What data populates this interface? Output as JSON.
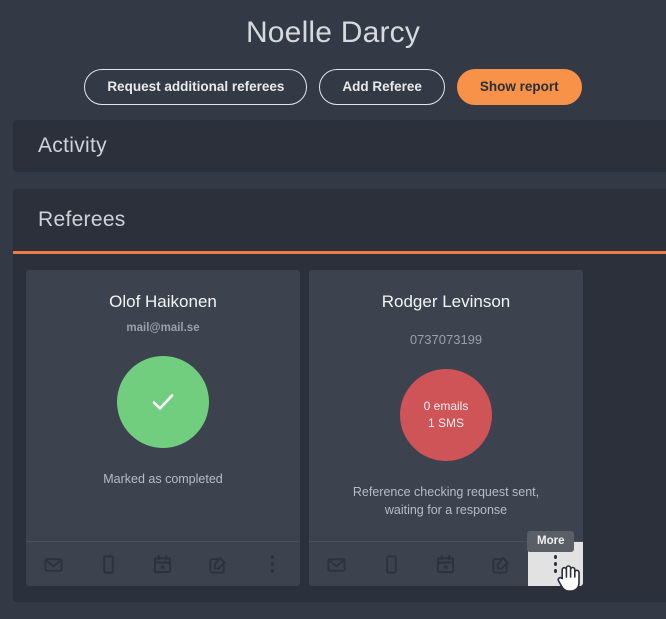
{
  "header": {
    "candidate_name": "Noelle Darcy",
    "actions": [
      {
        "label": "Request additional referees",
        "style": "outline",
        "name": "request-additional-referees-button"
      },
      {
        "label": "Add Referee",
        "style": "outline",
        "name": "add-referee-button"
      },
      {
        "label": "Show report",
        "style": "primary",
        "name": "show-report-button"
      }
    ]
  },
  "panels": {
    "activity": {
      "title": "Activity"
    },
    "referees": {
      "title": "Referees",
      "accent_color": "#ef7b42"
    }
  },
  "referees": [
    {
      "name": "Olof Haikonen",
      "contact": "mail@mail.se",
      "contact_type": "email",
      "circle_color": "#72ce7f",
      "circle_kind": "check",
      "circle_lines": [],
      "status_text": "Marked as completed",
      "actions": [
        {
          "icon": "envelope-icon",
          "label": "Send email"
        },
        {
          "icon": "mobile-phone-icon",
          "label": "Send SMS"
        },
        {
          "icon": "calendar-icon",
          "label": "Schedule"
        },
        {
          "icon": "edit-icon",
          "label": "Edit"
        },
        {
          "icon": "more-vertical-icon",
          "label": "More"
        }
      ]
    },
    {
      "name": "Rodger Levinson",
      "contact": "0737073199",
      "contact_type": "phone",
      "circle_color": "#ce5458",
      "circle_kind": "counts",
      "circle_lines": [
        "0 emails",
        "1 SMS"
      ],
      "status_text": "Reference checking request sent, waiting for a response",
      "actions": [
        {
          "icon": "envelope-icon",
          "label": "Send email"
        },
        {
          "icon": "mobile-phone-icon",
          "label": "Send SMS"
        },
        {
          "icon": "calendar-icon",
          "label": "Schedule"
        },
        {
          "icon": "edit-icon",
          "label": "Edit"
        },
        {
          "icon": "more-vertical-icon",
          "label": "More"
        }
      ]
    }
  ],
  "tooltip": {
    "text": "More"
  },
  "colors": {
    "page_background": "#343a45",
    "panel_background": "#2b303a",
    "card_background": "#3d434e",
    "accent_orange": "#f79248",
    "success_green": "#72ce7f",
    "danger_red": "#ce5458",
    "hover_highlight": "#e2e2e2"
  }
}
